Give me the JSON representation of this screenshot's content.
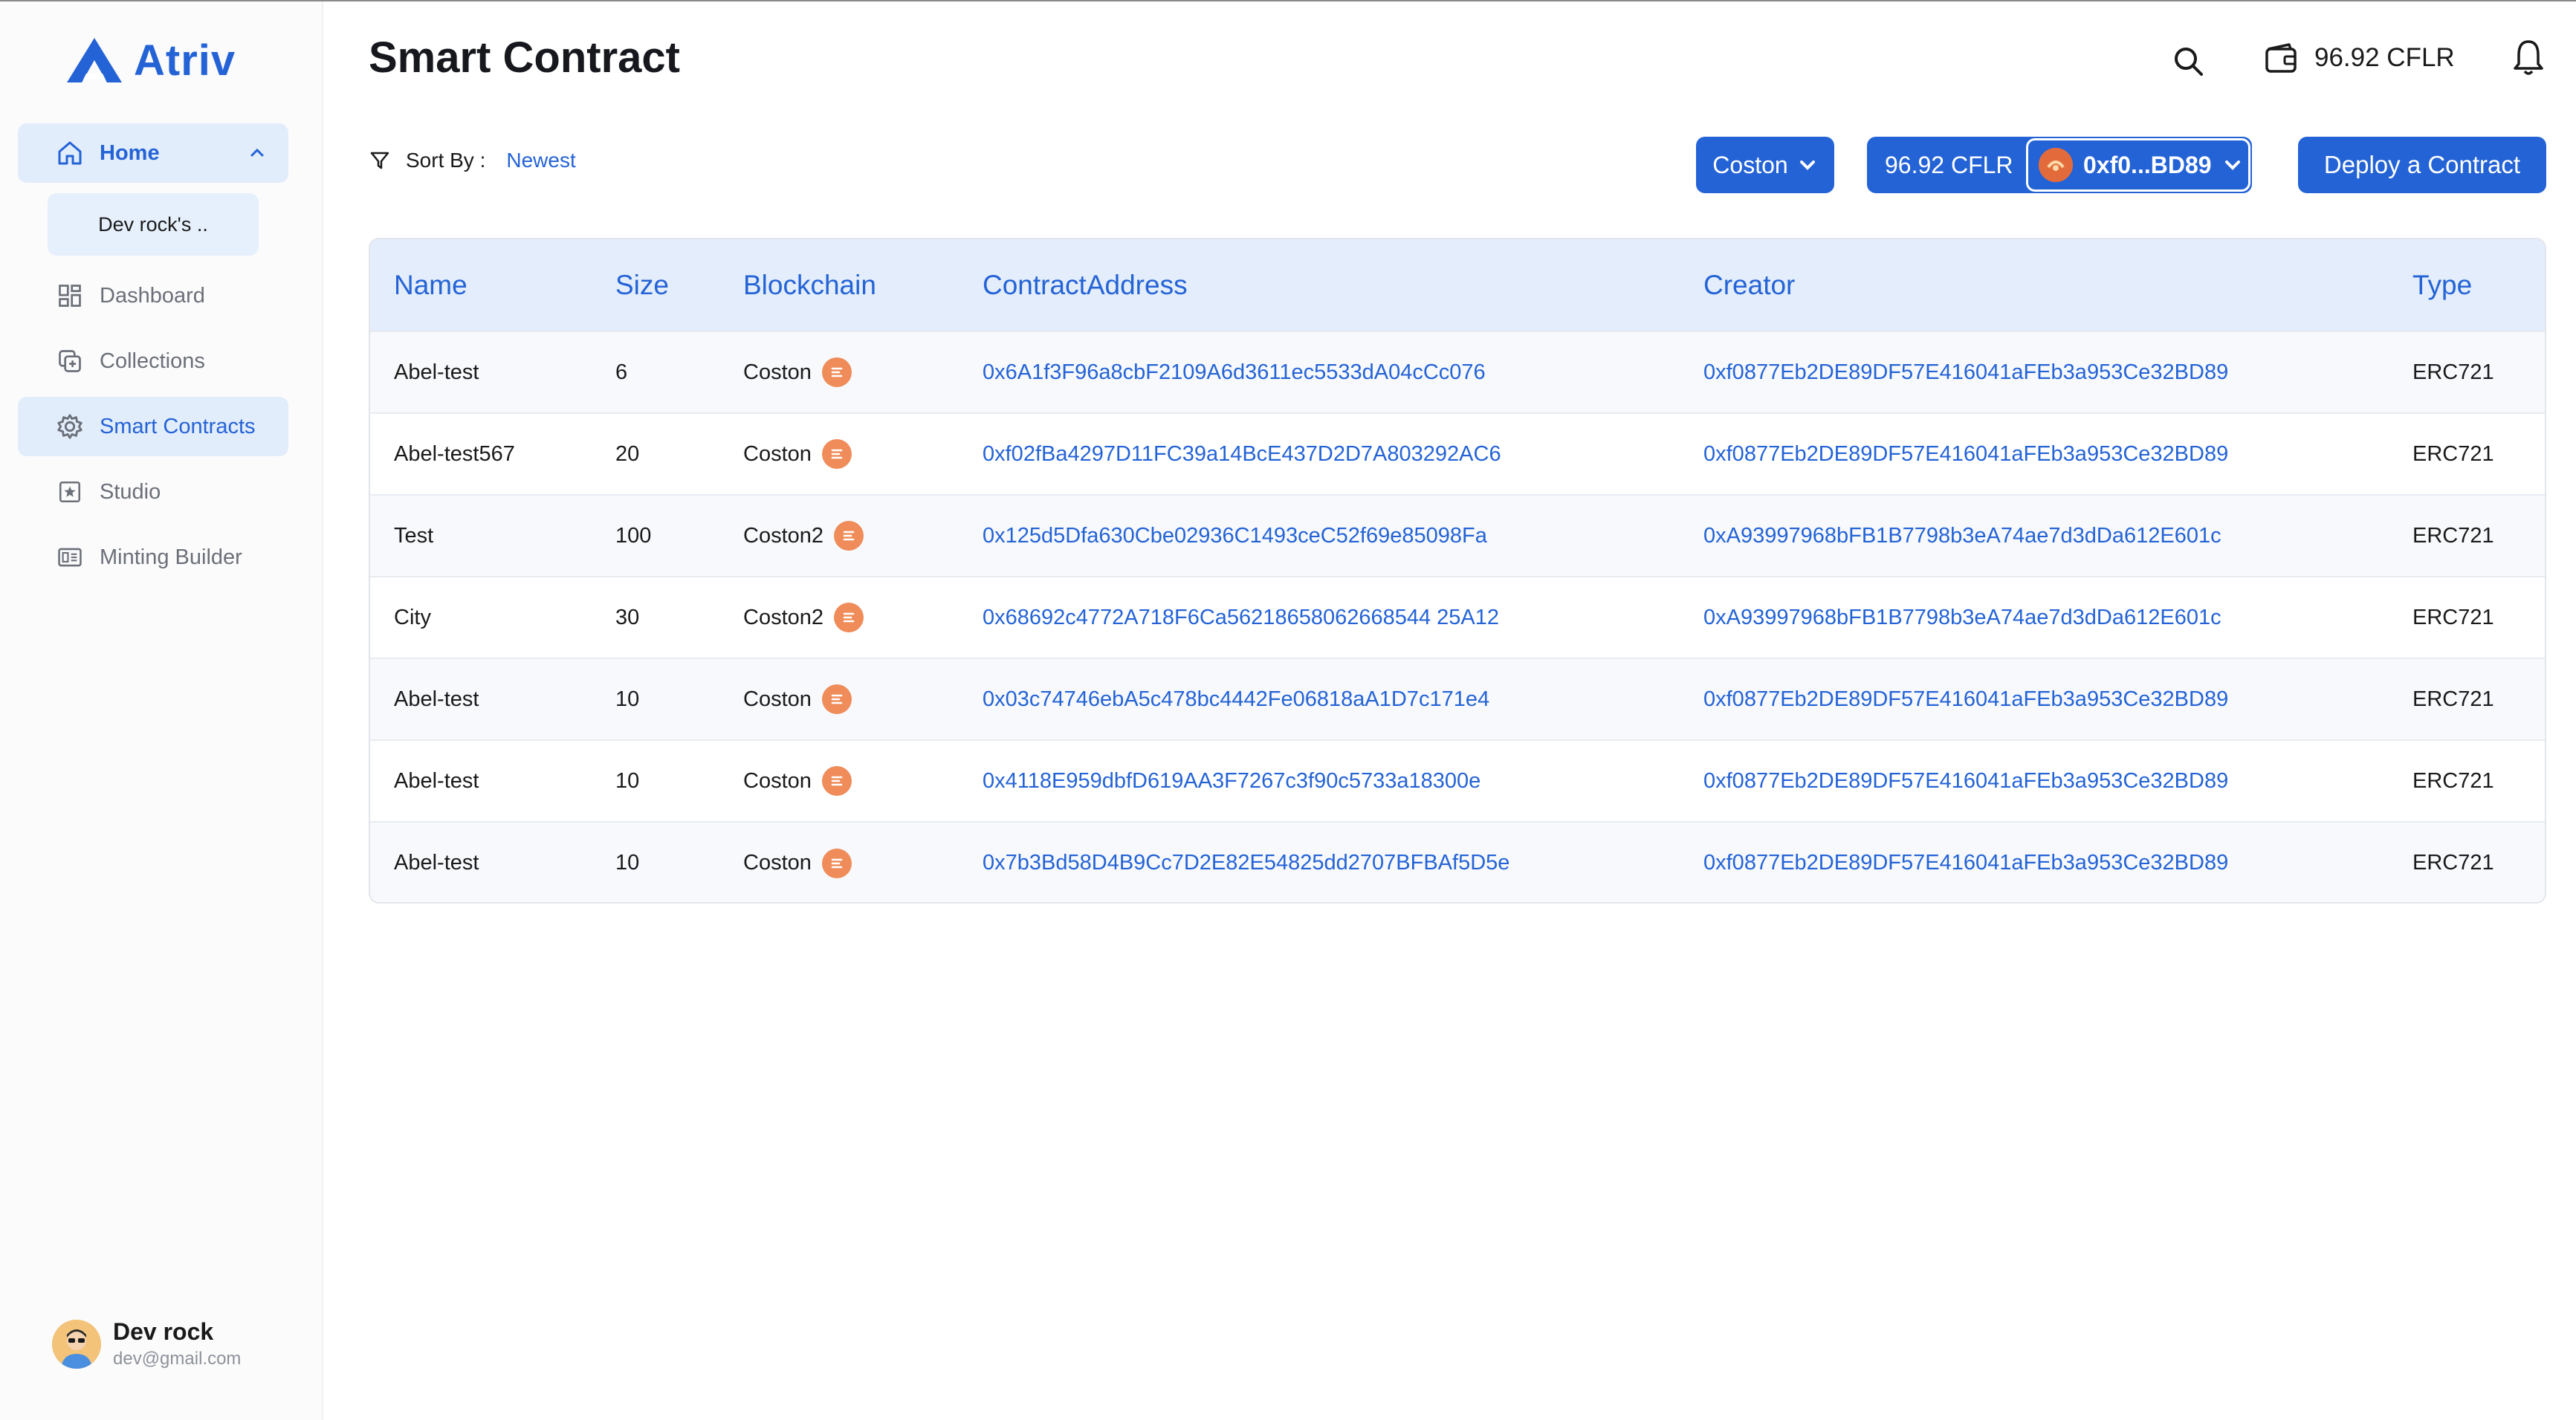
{
  "brand": {
    "name": "Atriv",
    "color": "#2463d6"
  },
  "sidebar": {
    "home_label": "Home",
    "sub_item": "Dev rock's ..",
    "items": [
      {
        "label": "Dashboard",
        "icon": "dashboard-icon"
      },
      {
        "label": "Collections",
        "icon": "collections-icon"
      },
      {
        "label": "Smart Contracts",
        "icon": "gear-icon",
        "active": true
      },
      {
        "label": "Studio",
        "icon": "studio-icon"
      },
      {
        "label": "Minting Builder",
        "icon": "minting-builder-icon"
      }
    ],
    "user": {
      "name": "Dev rock",
      "email": "dev@gmail.com"
    }
  },
  "header": {
    "title": "Smart Contract",
    "wallet_balance": "96.92 CFLR"
  },
  "toolbar": {
    "sort_label": "Sort By :",
    "sort_value": "Newest",
    "network": "Coston",
    "account_balance": "96.92 CFLR",
    "account_address": "0xf0...BD89",
    "deploy_label": "Deploy a Contract"
  },
  "table": {
    "columns": [
      "Name",
      "Size",
      "Blockchain",
      "ContractAddress",
      "Creator",
      "Type"
    ],
    "rows": [
      {
        "name": "Abel-test",
        "size": "6",
        "chain": "Coston",
        "address": "0x6A1f3F96a8cbF2109A6d3611ec5533dA04cCc076",
        "creator": "0xf0877Eb2DE89DF57E416041aFEb3a953Ce32BD89",
        "type": "ERC721"
      },
      {
        "name": "Abel-test567",
        "size": "20",
        "chain": "Coston",
        "address": "0xf02fBa4297D11FC39a14BcE437D2D7A803292AC6",
        "creator": "0xf0877Eb2DE89DF57E416041aFEb3a953Ce32BD89",
        "type": "ERC721"
      },
      {
        "name": "Test",
        "size": "100",
        "chain": "Coston2",
        "address": "0x125d5Dfa630Cbe02936C1493ceC52f69e85098Fa",
        "creator": "0xA93997968bFB1B7798b3eA74ae7d3dDa612E601c",
        "type": "ERC721"
      },
      {
        "name": "City",
        "size": "30",
        "chain": "Coston2",
        "address": "0x68692c4772A718F6Ca56218658062668544 25A12",
        "creator": "0xA93997968bFB1B7798b3eA74ae7d3dDa612E601c",
        "type": "ERC721"
      },
      {
        "name": "Abel-test",
        "size": "10",
        "chain": "Coston",
        "address": "0x03c74746ebA5c478bc4442Fe06818aA1D7c171e4",
        "creator": "0xf0877Eb2DE89DF57E416041aFEb3a953Ce32BD89",
        "type": "ERC721"
      },
      {
        "name": "Abel-test",
        "size": "10",
        "chain": "Coston",
        "address": "0x4118E959dbfD619AA3F7267c3f90c5733a18300e",
        "creator": "0xf0877Eb2DE89DF57E416041aFEb3a953Ce32BD89",
        "type": "ERC721"
      },
      {
        "name": "Abel-test",
        "size": "10",
        "chain": "Coston",
        "address": "0x7b3Bd58D4B9Cc7D2E82E54825dd2707BFBAf5D5e",
        "creator": "0xf0877Eb2DE89DF57E416041aFEb3a953Ce32BD89",
        "type": "ERC721"
      }
    ]
  }
}
